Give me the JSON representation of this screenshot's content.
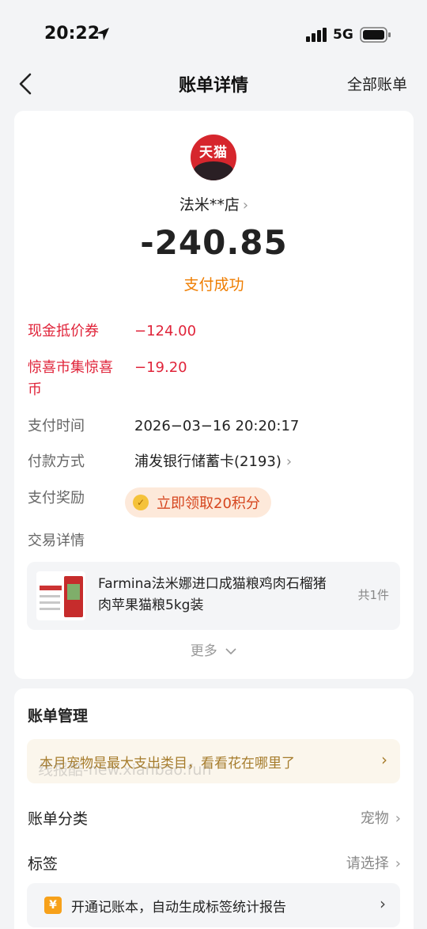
{
  "status_bar": {
    "time": "20:22",
    "network": "5G"
  },
  "nav": {
    "title": "账单详情",
    "right_link": "全部账单"
  },
  "merchant": {
    "logo_text": "天猫",
    "name": "法米**店"
  },
  "payment": {
    "amount": "-240.85",
    "status": "支付成功"
  },
  "details": [
    {
      "label": "现金抵价券",
      "value": "−124.00"
    },
    {
      "label": "惊喜市集惊喜币",
      "value": "−19.20"
    },
    {
      "label": "支付时间",
      "value": "2026−03−16 20:20:17"
    },
    {
      "label": "付款方式",
      "value": "浦发银行储蓄卡(2193)"
    },
    {
      "label": "支付奖励",
      "value": "立即领取20积分"
    },
    {
      "label": "交易详情",
      "value": ""
    }
  ],
  "product": {
    "name": "Farmina法米娜进口成猫粮鸡肉石榴猪肉苹果猫粮5kg装",
    "count": "共1件"
  },
  "more_label": "更多",
  "manage": {
    "title": "账单管理",
    "tip": "本月宠物是最大支出类目，看看花在哪里了",
    "watermark": "线报酷-new.xianbao.fun",
    "category_label": "账单分类",
    "category_value": "宠物",
    "tag_label": "标签",
    "tag_value": "请选择",
    "notebook_icon": "¥",
    "notebook_text": "开通记账本，自动生成标签统计报告"
  },
  "colors": {
    "accent": "#ef7d00",
    "discount": "#e0243a",
    "reward": "#d6461f"
  }
}
